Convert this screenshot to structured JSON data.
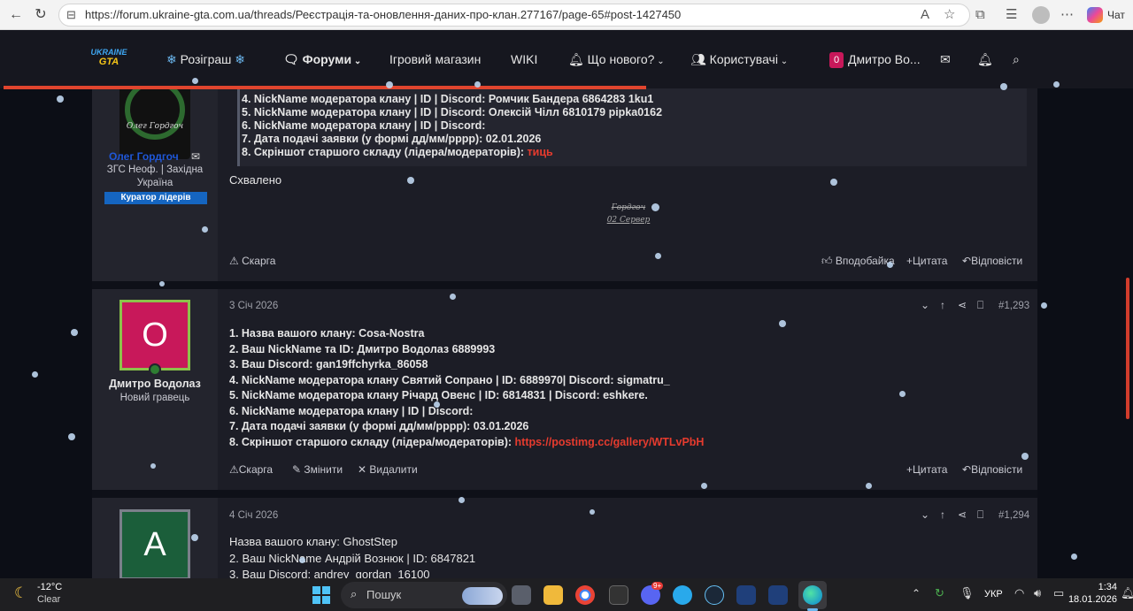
{
  "browser": {
    "url": "https://forum.ukraine-gta.com.ua/threads/Реєстрація-та-оновлення-даних-про-клан.277167/page-65#post-1427450",
    "chat_label": "Чат"
  },
  "forum_nav": {
    "logo_line1": "UKRAINE",
    "logo_line2": "GTA",
    "items": [
      "Розіграш",
      "Форуми",
      "Ігровий магазин",
      "WIKI",
      "Що нового?",
      "Користувачі"
    ],
    "user_badge": "0",
    "user_name": "Дмитро Во..."
  },
  "post_top": {
    "avatar_caption": "Олег Гордгоч",
    "username": "Олег Гордгоч",
    "role_line1": "ЗГС Неоф. | Західна",
    "role_line2": "Україна",
    "banner": "Куратор лідерів",
    "quote_lines": [
      "4. NickName модератора клану | ID | Discord: Ромчик Бандера 6864283 1ku1",
      "5. NickName модератора клану | ID | Discord: Олексій Чілл 6810179 pipka0162",
      "6. NickName модератора клану | ID | Discord:",
      "7. Дата подачі заявки (у формі дд/мм/рррр): 02.01.2026",
      "8. Скріншот старшого складу (лідера/модераторів): "
    ],
    "quote_link": "тиць",
    "body": "Схвалено",
    "signature_line1": "Гордгоч",
    "signature_line2": "02  Сервер",
    "actions": {
      "report": "Скарга",
      "like": "Вподобайка",
      "quote": "+Цитата",
      "reply": "Відповісти"
    }
  },
  "post_mid": {
    "date": "3 Січ 2026",
    "number": "#1,293",
    "avatar_letter": "О",
    "username": "Дмитро Водолаз",
    "rank": "Новий гравець",
    "lines": [
      "1. Назва вашого клану: Cosa-Nostra",
      "2. Ваш NickName та ID: Дмитро Водолаз 6889993",
      "3. Ваш Discord: gan19ffchyrka_86058",
      "4. NickName модератора клану Святий Сопрано | ID: 6889970| Discord: sigmatru_",
      "5. NickName модератора клану Річард Овенс | ID: 6814831 | Discord: eshkere.",
      "6. NickName модератора клану | ID | Discord:",
      "7. Дата подачі заявки (у формі дд/мм/рррр): 03.01.2026",
      "8. Скріншот старшого складу (лідера/модераторів): "
    ],
    "link": "https://postimg.cc/gallery/WTLvPbH",
    "actions": {
      "report": "Скарга",
      "edit": "Змінити",
      "delete": "Видалити",
      "quote": "+Цитата",
      "reply": "Відповісти"
    }
  },
  "post_bottom": {
    "date": "4 Січ 2026",
    "number": "#1,294",
    "avatar_letter": "А",
    "lines": [
      "Назва вашого клану: GhostStep",
      "2. Ваш NickName Андрій Вознюк | ID: 6847821",
      "3. Ваш Discord: andrey_gordan_16100"
    ]
  },
  "taskbar": {
    "weather_temp": "-12°C",
    "weather_desc": "Clear",
    "search_placeholder": "Пошук",
    "lang": "УКР",
    "time": "1:34",
    "date": "18.01.2026",
    "badge": "9+"
  },
  "colors": {
    "accent_red": "#e0452e",
    "avatar_pink": "#c8185a",
    "avatar_green": "#1b5e3a",
    "link_red": "#e63b2e",
    "banner_blue": "#1565c0"
  }
}
